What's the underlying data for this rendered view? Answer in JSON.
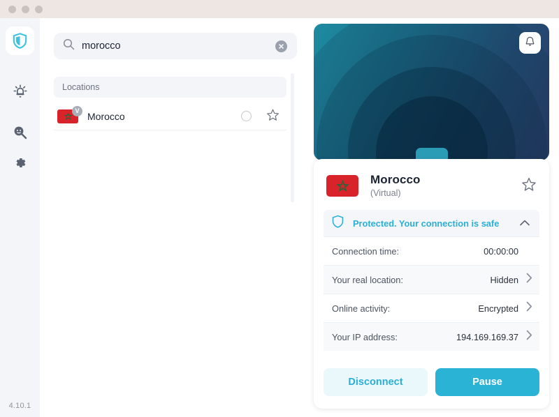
{
  "window": {
    "traffic_lights": [
      "close",
      "minimize",
      "maximize"
    ],
    "version": "4.10.1"
  },
  "sidebar": {
    "items": [
      {
        "icon": "shield-icon",
        "name": "vpn",
        "active": true
      },
      {
        "icon": "alert-icon",
        "name": "alerts",
        "active": false
      },
      {
        "icon": "scanner-icon",
        "name": "scanner",
        "active": false
      },
      {
        "icon": "gear-icon",
        "name": "settings",
        "active": false
      }
    ]
  },
  "search": {
    "value": "morocco",
    "placeholder": "Search",
    "icon": "search-icon",
    "clear_icon": "close-icon"
  },
  "locations": {
    "header": "Locations",
    "rows": [
      {
        "name": "Morocco",
        "flag": "morocco-flag",
        "virtual_badge": "V",
        "selected": false,
        "favorite": false
      }
    ]
  },
  "hero": {
    "notification_icon": "bell-icon"
  },
  "card": {
    "title": "Morocco",
    "subtitle": "(Virtual)",
    "flag": "morocco-flag",
    "favorite_icon": "star-icon",
    "status": {
      "icon": "shield-icon",
      "text": "Protected. Your connection is safe",
      "chevron": "chevron-up-icon",
      "color": "#2bafd4"
    },
    "details": [
      {
        "label": "Connection time:",
        "value": "00:00:00",
        "chevron": false
      },
      {
        "label": "Your real location:",
        "value": "Hidden",
        "chevron": true
      },
      {
        "label": "Online activity:",
        "value": "Encrypted",
        "chevron": true
      },
      {
        "label": "Your IP address:",
        "value": "194.169.169.37",
        "chevron": true
      }
    ],
    "buttons": {
      "disconnect": "Disconnect",
      "pause": "Pause"
    }
  },
  "colors": {
    "accent": "#2bb3d6",
    "accent_text": "#2bafd4",
    "flag_red": "#d8232a",
    "flag_star": "#1a6a3c",
    "sidebar_bg": "#f4f5f8",
    "titlebar_bg": "#eee6e3"
  }
}
